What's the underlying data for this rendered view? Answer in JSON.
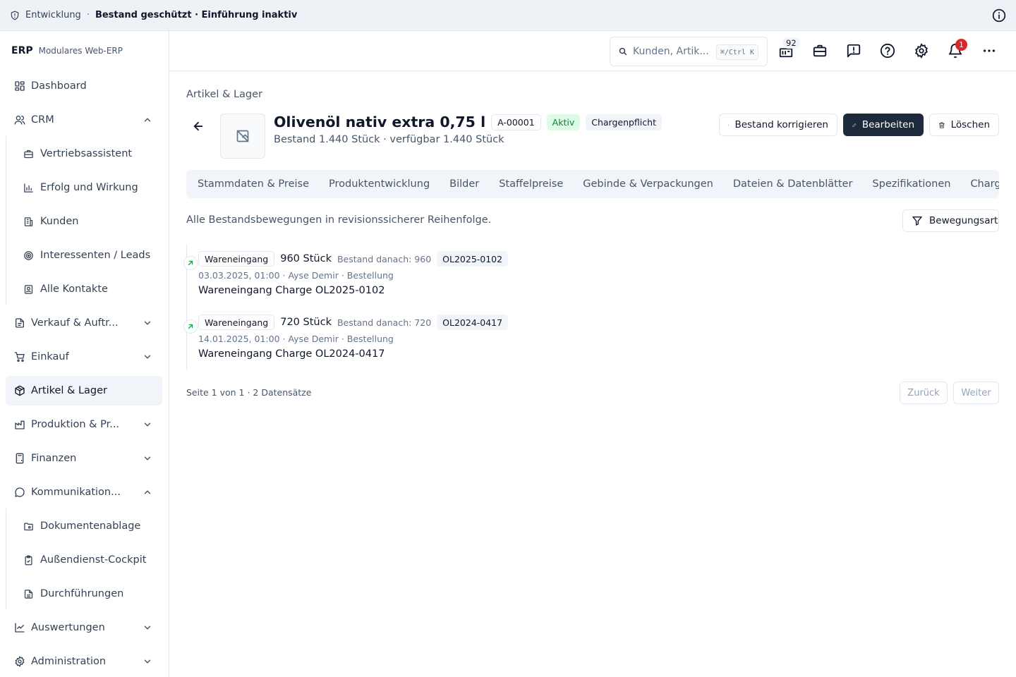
{
  "banner": {
    "environment": "Entwicklung",
    "separator": "·",
    "status": "Bestand geschützt · Einführung inaktiv"
  },
  "sidebar": {
    "brand": "ERP",
    "brand_sub": "Modulares Web-ERP",
    "items": [
      {
        "label": "Dashboard",
        "icon": "dashboard-icon"
      },
      {
        "label": "CRM",
        "icon": "users-icon",
        "expanded": true
      },
      {
        "label": "Vertriebsassistent",
        "icon": "briefcase-icon"
      },
      {
        "label": "Erfolg und Wirkung",
        "icon": "bar-chart-icon"
      },
      {
        "label": "Kunden",
        "icon": "building-icon"
      },
      {
        "label": "Interessenten / Leads",
        "icon": "target-icon"
      },
      {
        "label": "Alle Kontakte",
        "icon": "contact-icon"
      },
      {
        "label": "Verkauf & Auftr...",
        "icon": "document-icon"
      },
      {
        "label": "Einkauf",
        "icon": "cart-icon"
      },
      {
        "label": "Artikel & Lager",
        "icon": "package-icon",
        "active": true
      },
      {
        "label": "Produktion & Pr...",
        "icon": "factory-icon"
      },
      {
        "label": "Finanzen",
        "icon": "calculator-icon"
      },
      {
        "label": "Kommunikation...",
        "icon": "chat-icon",
        "expanded": true
      },
      {
        "label": "Dokumentenablage",
        "icon": "folder-icon"
      },
      {
        "label": "Außendienst-Cockpit",
        "icon": "clipboard-icon"
      },
      {
        "label": "Durchführungen",
        "icon": "file-icon"
      },
      {
        "label": "Auswertungen",
        "icon": "chart-icon"
      },
      {
        "label": "Administration",
        "icon": "gear-icon"
      }
    ]
  },
  "header": {
    "search_placeholder": "Kunden, Artik...",
    "search_shortcut": "⌘/Ctrl K",
    "tasks_count": "92",
    "notifications_count": "1"
  },
  "page": {
    "breadcrumb": "Artikel & Lager",
    "title": "Olivenöl nativ extra 0,75 l",
    "sku": "A-00001",
    "status": "Aktiv",
    "batch_flag": "Chargenpflicht",
    "subtitle": "Bestand 1.440 Stück · verfügbar 1.440 Stück",
    "actions": {
      "correct": "Bestand korrigieren",
      "edit": "Bearbeiten",
      "delete": "Löschen"
    },
    "tabs": [
      "Stammdaten & Preise",
      "Produktentwicklung",
      "Bilder",
      "Staffelpreise",
      "Gebinde & Verpackungen",
      "Dateien & Datenblätter",
      "Spezifikationen",
      "Chargen &"
    ],
    "description": "Alle Bestandsbewegungen in revisionssicherer Reihenfolge.",
    "filter_label": "Bewegungsart",
    "movements": [
      {
        "type": "Wareneingang",
        "qty": "960 Stück",
        "after": "Bestand danach: 960",
        "batch": "OL2025-0102",
        "meta": "03.03.2025, 01:00 · Ayse Demir · Bestellung",
        "note": "Wareneingang Charge OL2025-0102"
      },
      {
        "type": "Wareneingang",
        "qty": "720 Stück",
        "after": "Bestand danach: 720",
        "batch": "OL2024-0417",
        "meta": "14.01.2025, 01:00 · Ayse Demir · Bestellung",
        "note": "Wareneingang Charge OL2024-0417"
      }
    ],
    "pager": {
      "info": "Seite 1 von 1 · 2 Datensätze",
      "prev": "Zurück",
      "next": "Weiter"
    }
  },
  "colors": {
    "primary": "#1e293b",
    "active_green": "#15803d",
    "notification_red": "#dc2626",
    "banner_bg": "#eef2f7"
  }
}
